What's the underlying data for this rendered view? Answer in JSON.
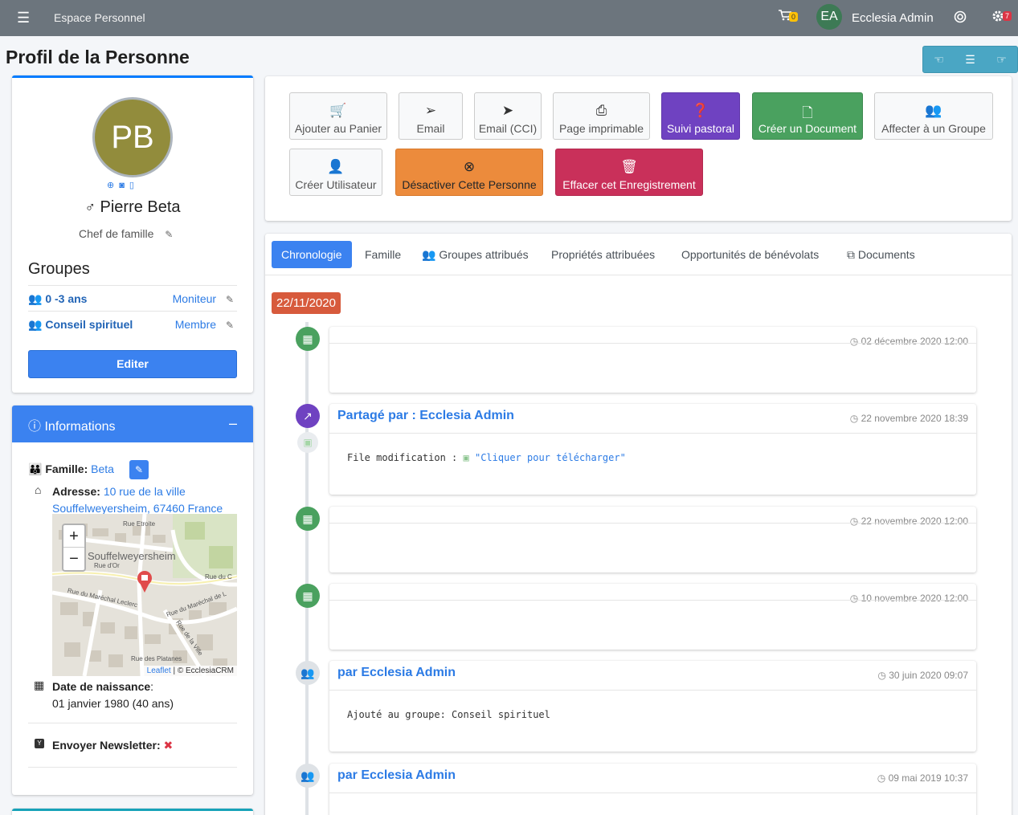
{
  "topbar": {
    "menu_icon": "☰",
    "brand": "Espace Personnel",
    "cart_count": "0",
    "user_initials": "EA",
    "user_name": "Ecclesia Admin",
    "notif_count": "7"
  },
  "page": {
    "title": "Profil de la Personne"
  },
  "profile": {
    "initials": "PB",
    "name": "Pierre Beta",
    "role": "Chef de famille",
    "groups_title": "Groupes",
    "groups": [
      {
        "name": "0 -3 ans",
        "role": "Moniteur"
      },
      {
        "name": "Conseil spirituel",
        "role": "Membre"
      }
    ],
    "edit_button": "Editer"
  },
  "info": {
    "header": "Informations",
    "family_label": "Famille:",
    "family_value": "Beta",
    "address_label": "Adresse:",
    "address_line1": "10 rue de la ville",
    "address_line2": "Souffelweyersheim, 67460 France",
    "map": {
      "zoom_in": "+",
      "zoom_out": "−",
      "town": "Souffelweyersheim",
      "streets": [
        "Rue Etroite",
        "Rue d'Or",
        "Rue du Maréchal Leclerc",
        "Rue du Maréchal de L",
        "Rue du C",
        "Rue de la Ville",
        "Rue des Platanes"
      ],
      "attr_leaflet": "Leaflet",
      "attr_rest": "| © EcclesiaCRM"
    },
    "birth_label": "Date de naissance",
    "birth_value": "01 janvier 1980 (40 ans)",
    "newsletter_label": "Envoyer Newsletter:",
    "newsletter_value": "✖"
  },
  "actions": [
    {
      "label": "Ajouter au Panier",
      "icon": "cart-plus-icon"
    },
    {
      "label": "Email",
      "icon": "paper-plane-outline-icon"
    },
    {
      "label": "Email (CCI)",
      "icon": "paper-plane-icon"
    },
    {
      "label": "Page imprimable",
      "icon": "printer-icon"
    },
    {
      "label": "Suivi pastoral",
      "icon": "question-circle-icon"
    },
    {
      "label": "Créer un Document",
      "icon": "file-icon"
    },
    {
      "label": "Affecter à un Groupe",
      "icon": "users-icon"
    },
    {
      "label": "Créer Utilisateur",
      "icon": "user-secret-icon"
    },
    {
      "label": "Désactiver Cette Personne",
      "icon": "times-circle-icon"
    },
    {
      "label": "Effacer cet Enregistrement",
      "icon": "trash-icon"
    }
  ],
  "tabs": [
    "Chronologie",
    "Famille",
    "Groupes attribués",
    "Propriétés attribuées",
    "Opportunités de bénévolats",
    "Documents"
  ],
  "timeline": {
    "date_label": "22/11/2020",
    "items": [
      {
        "time": "02 décembre 2020 12:00"
      },
      {
        "header": "Partagé par : Ecclesia Admin",
        "time": "22 novembre 2020 18:39",
        "body_prefix": "File modification : ",
        "body_link": "\"Cliquer pour télécharger\""
      },
      {
        "time": "22 novembre 2020 12:00"
      },
      {
        "time": "10 novembre 2020 12:00"
      },
      {
        "header": "par Ecclesia Admin",
        "time": "30 juin 2020 09:07",
        "body": "Ajouté au groupe: Conseil spirituel"
      },
      {
        "header": "par Ecclesia Admin",
        "time": "09 mai 2019 10:37"
      }
    ]
  }
}
